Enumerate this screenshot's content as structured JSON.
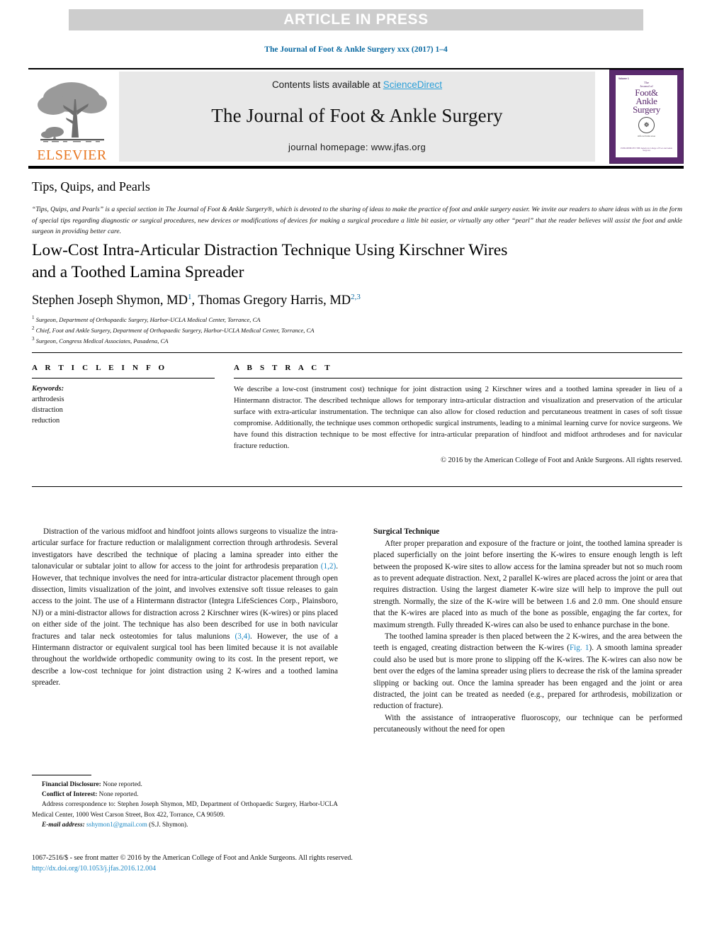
{
  "banner": {
    "label": "ARTICLE IN PRESS"
  },
  "running_head": "The Journal of Foot & Ankle Surgery xxx (2017) 1–4",
  "masthead": {
    "publisher_name": "ELSEVIER",
    "contents_prefix": "Contents lists available at ",
    "contents_link": "ScienceDirect",
    "journal_title": "The Journal of Foot & Ankle Surgery",
    "homepage": "journal homepage: www.jfas.org",
    "cover": {
      "issue_label": "Volume 1",
      "line_the": "The",
      "line_journal": "Journal of",
      "word_foot": "Foot&",
      "word_ankle": "Ankle",
      "word_surgery": "Surgery",
      "seal_glyph": "☸",
      "sub": "Official Publication",
      "foot": "PUBLISHED BY THE\nAmerican College of Foot and Ankle Surgeons"
    }
  },
  "section_label": "Tips, Quips, and Pearls",
  "blurb": "“Tips, Quips, and Pearls” is a special section in The Journal of Foot & Ankle Surgery®, which is devoted to the sharing of ideas to make the practice of foot and ankle surgery easier. We invite our readers to share ideas with us in the form of special tips regarding diagnostic or surgical procedures, new devices or modifications of devices for making a surgical procedure a little bit easier, or virtually any other “pearl” that the reader believes will assist the foot and ankle surgeon in providing better care.",
  "article": {
    "title_line1": "Low-Cost Intra-Articular Distraction Technique Using Kirschner Wires",
    "title_line2": "and a Toothed Lamina Spreader",
    "author1": "Stephen Joseph Shymon, MD",
    "author1_sup": "1",
    "author_sep": ", ",
    "author2": "Thomas Gregory Harris, MD",
    "author2_sup": "2,3",
    "affiliations": [
      {
        "sup": "1",
        "text": "Surgeon, Department of Orthopaedic Surgery, Harbor-UCLA Medical Center, Torrance, CA"
      },
      {
        "sup": "2",
        "text": "Chief, Foot and Ankle Surgery, Department of Orthopaedic Surgery, Harbor-UCLA Medical Center, Torrance, CA"
      },
      {
        "sup": "3",
        "text": "Surgeon, Congress Medical Associates, Pasadena, CA"
      }
    ]
  },
  "info": {
    "heading": "A R T I C L E   I N F O",
    "keywords_head": "Keywords:",
    "keywords": [
      "arthrodesis",
      "distraction",
      "reduction"
    ]
  },
  "abstract": {
    "heading": "A B S T R A C T",
    "body": "We describe a low-cost (instrument cost) technique for joint distraction using 2 Kirschner wires and a toothed lamina spreader in lieu of a Hintermann distractor. The described technique allows for temporary intra-articular distraction and visualization and preservation of the articular surface with extra-articular instrumentation. The technique can also allow for closed reduction and percutaneous treatment in cases of soft tissue compromise. Additionally, the technique uses common orthopedic surgical instruments, leading to a minimal learning curve for novice surgeons. We have found this distraction technique to be most effective for intra-articular preparation of hindfoot and midfoot arthrodeses and for navicular fracture reduction.",
    "copyright": "© 2016 by the American College of Foot and Ankle Surgeons. All rights reserved."
  },
  "body": {
    "left_p1_a": "Distraction of the various midfoot and hindfoot joints allows surgeons to visualize the intra-articular surface for fracture reduction or malalignment correction through arthrodesis. Several investigators have described the technique of placing a lamina spreader into either the talonavicular or subtalar joint to allow for access to the joint for arthrodesis preparation ",
    "left_cite1": "(1,2)",
    "left_p1_b": ". However, that technique involves the need for intra-articular distractor placement through open dissection, limits visualization of the joint, and involves extensive soft tissue releases to gain access to the joint. The use of a Hintermann distractor (Integra LifeSciences Corp., Plainsboro, NJ) or a mini-distractor allows for distraction across 2 Kirschner wires (K-wires) or pins placed on either side of the joint. The technique has also been described for use in both navicular fractures and talar neck osteotomies for talus malunions ",
    "left_cite2": "(3,4)",
    "left_p1_c": ". However, the use of a Hintermann distractor or equivalent surgical tool has been limited because it is not available throughout the worldwide orthopedic community owing to its cost. In the present report, we describe a low-cost technique for joint distraction using 2 K-wires and a toothed lamina spreader.",
    "right_heading": "Surgical Technique",
    "right_p1": "After proper preparation and exposure of the fracture or joint, the toothed lamina spreader is placed superficially on the joint before inserting the K-wires to ensure enough length is left between the proposed K-wire sites to allow access for the lamina spreader but not so much room as to prevent adequate distraction. Next, 2 parallel K-wires are placed across the joint or area that requires distraction. Using the largest diameter K-wire size will help to improve the pull out strength. Normally, the size of the K-wire will be between 1.6 and 2.0 mm. One should ensure that the K-wires are placed into as much of the bone as possible, engaging the far cortex, for maximum strength. Fully threaded K-wires can also be used to enhance purchase in the bone.",
    "right_p2_a": "The toothed lamina spreader is then placed between the 2 K-wires, and the area between the teeth is engaged, creating distraction between the K-wires (",
    "right_fig_link": "Fig. 1",
    "right_p2_b": "). A smooth lamina spreader could also be used but is more prone to slipping off the K-wires. The K-wires can also now be bent over the edges of the lamina spreader using pliers to decrease the risk of the lamina spreader slipping or backing out. Once the lamina spreader has been engaged and the joint or area distracted, the joint can be treated as needed (e.g., prepared for arthrodesis, mobilization or reduction of fracture).",
    "right_p3": "With the assistance of intraoperative fluoroscopy, our technique can be performed percutaneously without the need for open"
  },
  "footnotes": {
    "financial_label": "Financial Disclosure:",
    "financial_value": " None reported.",
    "conflict_label": "Conflict of Interest:",
    "conflict_value": " None reported.",
    "address": "Address correspondence to: Stephen Joseph Shymon, MD, Department of Orthopaedic Surgery, Harbor-UCLA Medical Center, 1000 West Carson Street, Box 422, Torrance, CA 90509.",
    "email_label": "E-mail address:",
    "email": "sshymon1@gmail.com",
    "email_suffix": " (S.J. Shymon)."
  },
  "bottom": {
    "issn_line": "1067-2516/$ - see front matter © 2016 by the American College of Foot and Ankle Surgeons. All rights reserved.",
    "doi": "http://dx.doi.org/10.1053/j.jfas.2016.12.004"
  },
  "colors": {
    "link_blue": "#1a87c4",
    "header_blue": "#0b6aa2",
    "elsevier_orange": "#e87722",
    "banner_gray": "#cdcdcd",
    "masthead_gray": "#e8e8e8",
    "cover_purple": "#5b2a6e"
  }
}
